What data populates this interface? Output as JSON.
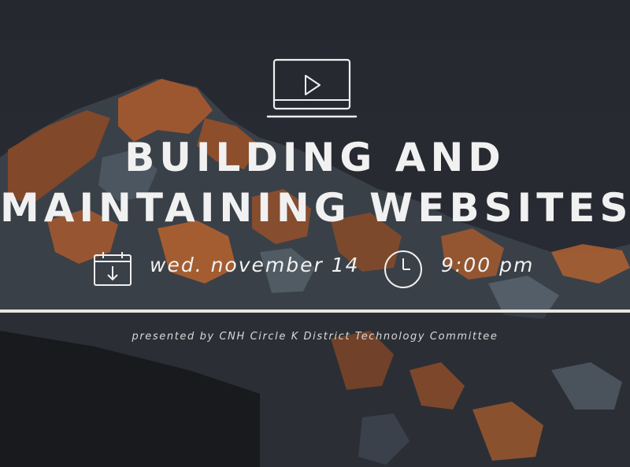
{
  "poster": {
    "title_line1": "BUILDING AND",
    "title_line2": "MAINTAINING WEBSITES",
    "date": "wed. november 14",
    "time": "9:00 pm",
    "presenter": "presented by CNH Circle K District Technology Committee"
  },
  "icons": {
    "header": "laptop-play-icon",
    "date": "calendar-download-icon",
    "time": "clock-icon"
  },
  "colors": {
    "background": "#26282f",
    "mountain_rock": "#a85a2e",
    "mountain_shadow": "#3a4047",
    "text": "#f1f1f1",
    "divider": "#e9e6e2"
  }
}
